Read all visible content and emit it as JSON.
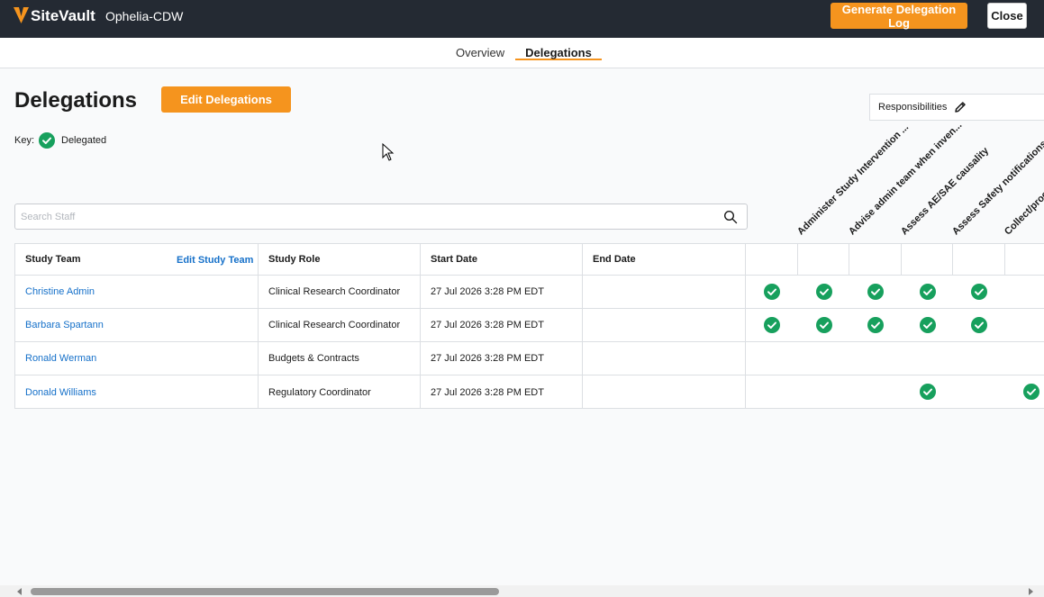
{
  "app": {
    "brand": "SiteVault",
    "study_name": "Ophelia-CDW"
  },
  "header": {
    "generate_label": "Generate Delegation Log",
    "close_label": "Close"
  },
  "tabs": [
    {
      "label": "Overview",
      "active": false
    },
    {
      "label": "Delegations",
      "active": true
    }
  ],
  "page": {
    "title": "Delegations",
    "edit_button_label": "Edit Delegations"
  },
  "key": {
    "label": "Key:",
    "item_label": "Delegated"
  },
  "responsibilities": {
    "button_label": "Responsibilities",
    "columns": [
      "Administer Study Intervention ...",
      "Advise admin team when inven...",
      "Assess AE/SAE causality",
      "Assess Safety notifications",
      "Collect/proces"
    ]
  },
  "search": {
    "placeholder": "Search Staff",
    "value": ""
  },
  "table": {
    "headers": {
      "study_team": "Study Team",
      "edit_team": "Edit Study Team",
      "study_role": "Study Role",
      "start_date": "Start Date",
      "end_date": "End Date"
    },
    "rows": [
      {
        "name": "Christine Admin",
        "role": "Clinical Research Coordinator",
        "start": "27 Jul 2026 3:28 PM EDT",
        "end": "",
        "delegated": [
          true,
          true,
          true,
          true,
          true,
          false
        ]
      },
      {
        "name": "Barbara Spartann",
        "role": "Clinical Research Coordinator",
        "start": "27 Jul 2026 3:28 PM EDT",
        "end": "",
        "delegated": [
          true,
          true,
          true,
          true,
          true,
          false
        ]
      },
      {
        "name": "Ronald Werman",
        "role": "Budgets & Contracts",
        "start": "27 Jul 2026 3:28 PM EDT",
        "end": "",
        "delegated": [
          false,
          false,
          false,
          false,
          false,
          false
        ]
      },
      {
        "name": "Donald Williams",
        "role": "Regulatory Coordinator",
        "start": "27 Jul 2026 3:28 PM EDT",
        "end": "",
        "delegated": [
          false,
          false,
          false,
          true,
          false,
          true
        ]
      }
    ]
  },
  "colors": {
    "accent": "#f5941e",
    "topbar": "#242a33",
    "link": "#1570c9",
    "check": "#17a05d"
  },
  "icons": [
    "sitevault-logo-icon",
    "check-circle-icon",
    "pencil-icon",
    "search-icon",
    "cursor-icon",
    "scroll-left-icon",
    "scroll-right-icon"
  ]
}
